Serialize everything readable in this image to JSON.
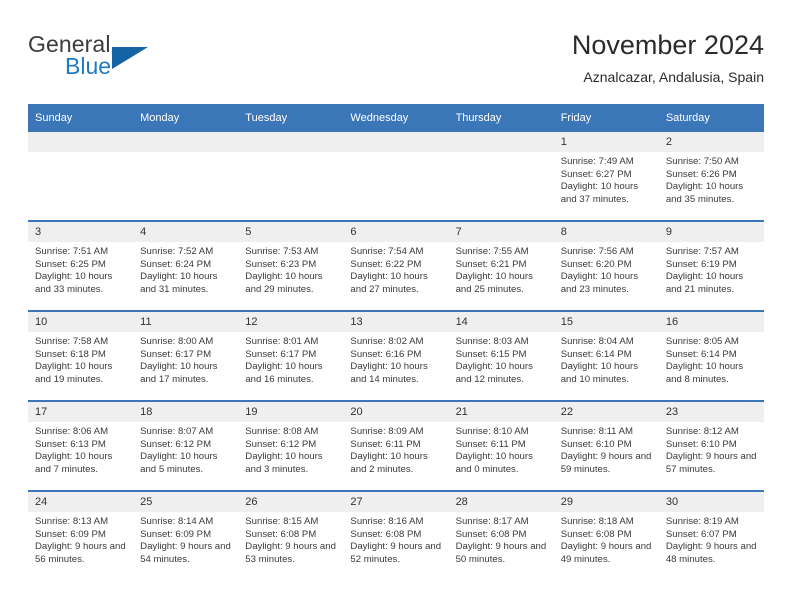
{
  "brand": {
    "name_part1": "General",
    "name_part2": "Blue"
  },
  "header": {
    "title": "November 2024",
    "subtitle": "Aznalcazar, Andalusia, Spain"
  },
  "colors": {
    "header_blue": "#3b76b8",
    "brand_blue": "#1f7ac4",
    "triangle_blue": "#1464a5",
    "daynum_bg": "#efefef",
    "text": "#3a3a3a"
  },
  "labels": {
    "sunrise_prefix": "Sunrise:",
    "sunset_prefix": "Sunset:",
    "daylight_prefix": "Daylight:"
  },
  "weekday_headers": [
    "Sunday",
    "Monday",
    "Tuesday",
    "Wednesday",
    "Thursday",
    "Friday",
    "Saturday"
  ],
  "weeks": [
    [
      {
        "day": "",
        "sunrise": "",
        "sunset": "",
        "daylight": ""
      },
      {
        "day": "",
        "sunrise": "",
        "sunset": "",
        "daylight": ""
      },
      {
        "day": "",
        "sunrise": "",
        "sunset": "",
        "daylight": ""
      },
      {
        "day": "",
        "sunrise": "",
        "sunset": "",
        "daylight": ""
      },
      {
        "day": "",
        "sunrise": "",
        "sunset": "",
        "daylight": ""
      },
      {
        "day": "1",
        "sunrise": "Sunrise: 7:49 AM",
        "sunset": "Sunset: 6:27 PM",
        "daylight": "Daylight: 10 hours and 37 minutes."
      },
      {
        "day": "2",
        "sunrise": "Sunrise: 7:50 AM",
        "sunset": "Sunset: 6:26 PM",
        "daylight": "Daylight: 10 hours and 35 minutes."
      }
    ],
    [
      {
        "day": "3",
        "sunrise": "Sunrise: 7:51 AM",
        "sunset": "Sunset: 6:25 PM",
        "daylight": "Daylight: 10 hours and 33 minutes."
      },
      {
        "day": "4",
        "sunrise": "Sunrise: 7:52 AM",
        "sunset": "Sunset: 6:24 PM",
        "daylight": "Daylight: 10 hours and 31 minutes."
      },
      {
        "day": "5",
        "sunrise": "Sunrise: 7:53 AM",
        "sunset": "Sunset: 6:23 PM",
        "daylight": "Daylight: 10 hours and 29 minutes."
      },
      {
        "day": "6",
        "sunrise": "Sunrise: 7:54 AM",
        "sunset": "Sunset: 6:22 PM",
        "daylight": "Daylight: 10 hours and 27 minutes."
      },
      {
        "day": "7",
        "sunrise": "Sunrise: 7:55 AM",
        "sunset": "Sunset: 6:21 PM",
        "daylight": "Daylight: 10 hours and 25 minutes."
      },
      {
        "day": "8",
        "sunrise": "Sunrise: 7:56 AM",
        "sunset": "Sunset: 6:20 PM",
        "daylight": "Daylight: 10 hours and 23 minutes."
      },
      {
        "day": "9",
        "sunrise": "Sunrise: 7:57 AM",
        "sunset": "Sunset: 6:19 PM",
        "daylight": "Daylight: 10 hours and 21 minutes."
      }
    ],
    [
      {
        "day": "10",
        "sunrise": "Sunrise: 7:58 AM",
        "sunset": "Sunset: 6:18 PM",
        "daylight": "Daylight: 10 hours and 19 minutes."
      },
      {
        "day": "11",
        "sunrise": "Sunrise: 8:00 AM",
        "sunset": "Sunset: 6:17 PM",
        "daylight": "Daylight: 10 hours and 17 minutes."
      },
      {
        "day": "12",
        "sunrise": "Sunrise: 8:01 AM",
        "sunset": "Sunset: 6:17 PM",
        "daylight": "Daylight: 10 hours and 16 minutes."
      },
      {
        "day": "13",
        "sunrise": "Sunrise: 8:02 AM",
        "sunset": "Sunset: 6:16 PM",
        "daylight": "Daylight: 10 hours and 14 minutes."
      },
      {
        "day": "14",
        "sunrise": "Sunrise: 8:03 AM",
        "sunset": "Sunset: 6:15 PM",
        "daylight": "Daylight: 10 hours and 12 minutes."
      },
      {
        "day": "15",
        "sunrise": "Sunrise: 8:04 AM",
        "sunset": "Sunset: 6:14 PM",
        "daylight": "Daylight: 10 hours and 10 minutes."
      },
      {
        "day": "16",
        "sunrise": "Sunrise: 8:05 AM",
        "sunset": "Sunset: 6:14 PM",
        "daylight": "Daylight: 10 hours and 8 minutes."
      }
    ],
    [
      {
        "day": "17",
        "sunrise": "Sunrise: 8:06 AM",
        "sunset": "Sunset: 6:13 PM",
        "daylight": "Daylight: 10 hours and 7 minutes."
      },
      {
        "day": "18",
        "sunrise": "Sunrise: 8:07 AM",
        "sunset": "Sunset: 6:12 PM",
        "daylight": "Daylight: 10 hours and 5 minutes."
      },
      {
        "day": "19",
        "sunrise": "Sunrise: 8:08 AM",
        "sunset": "Sunset: 6:12 PM",
        "daylight": "Daylight: 10 hours and 3 minutes."
      },
      {
        "day": "20",
        "sunrise": "Sunrise: 8:09 AM",
        "sunset": "Sunset: 6:11 PM",
        "daylight": "Daylight: 10 hours and 2 minutes."
      },
      {
        "day": "21",
        "sunrise": "Sunrise: 8:10 AM",
        "sunset": "Sunset: 6:11 PM",
        "daylight": "Daylight: 10 hours and 0 minutes."
      },
      {
        "day": "22",
        "sunrise": "Sunrise: 8:11 AM",
        "sunset": "Sunset: 6:10 PM",
        "daylight": "Daylight: 9 hours and 59 minutes."
      },
      {
        "day": "23",
        "sunrise": "Sunrise: 8:12 AM",
        "sunset": "Sunset: 6:10 PM",
        "daylight": "Daylight: 9 hours and 57 minutes."
      }
    ],
    [
      {
        "day": "24",
        "sunrise": "Sunrise: 8:13 AM",
        "sunset": "Sunset: 6:09 PM",
        "daylight": "Daylight: 9 hours and 56 minutes."
      },
      {
        "day": "25",
        "sunrise": "Sunrise: 8:14 AM",
        "sunset": "Sunset: 6:09 PM",
        "daylight": "Daylight: 9 hours and 54 minutes."
      },
      {
        "day": "26",
        "sunrise": "Sunrise: 8:15 AM",
        "sunset": "Sunset: 6:08 PM",
        "daylight": "Daylight: 9 hours and 53 minutes."
      },
      {
        "day": "27",
        "sunrise": "Sunrise: 8:16 AM",
        "sunset": "Sunset: 6:08 PM",
        "daylight": "Daylight: 9 hours and 52 minutes."
      },
      {
        "day": "28",
        "sunrise": "Sunrise: 8:17 AM",
        "sunset": "Sunset: 6:08 PM",
        "daylight": "Daylight: 9 hours and 50 minutes."
      },
      {
        "day": "29",
        "sunrise": "Sunrise: 8:18 AM",
        "sunset": "Sunset: 6:08 PM",
        "daylight": "Daylight: 9 hours and 49 minutes."
      },
      {
        "day": "30",
        "sunrise": "Sunrise: 8:19 AM",
        "sunset": "Sunset: 6:07 PM",
        "daylight": "Daylight: 9 hours and 48 minutes."
      }
    ]
  ]
}
